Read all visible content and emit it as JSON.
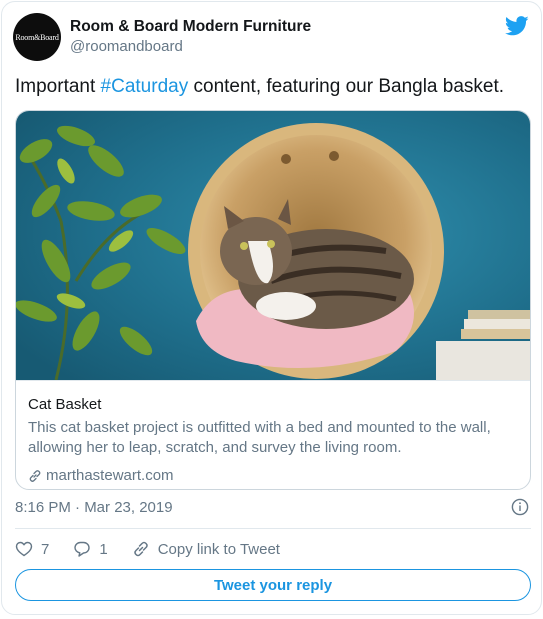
{
  "account": {
    "avatar_text": "Room&Board",
    "display_name": "Room & Board Modern Furniture",
    "handle": "@roomandboard"
  },
  "tweet": {
    "text_before": "Important ",
    "hashtag": "#Caturday",
    "text_after": " content, featuring our Bangla basket."
  },
  "card": {
    "title": "Cat Basket",
    "description": "This cat basket project is outfitted with a bed and mounted to the wall, allowing her to leap, scratch, and survey the living room.",
    "domain": "marthastewart.com"
  },
  "meta": {
    "timestamp": "8:16 PM · Mar 23, 2019"
  },
  "actions": {
    "likes": "7",
    "replies": "1",
    "copy_link": "Copy link to Tweet"
  },
  "reply_button": "Tweet your reply",
  "icons": [
    "twitter-bird-icon",
    "link-icon",
    "info-icon",
    "heart-icon",
    "reply-bubble-icon",
    "copy-link-icon"
  ],
  "colors": {
    "accent": "#1b95e0",
    "secondary_text": "#657786",
    "border": "#e1e8ed"
  }
}
